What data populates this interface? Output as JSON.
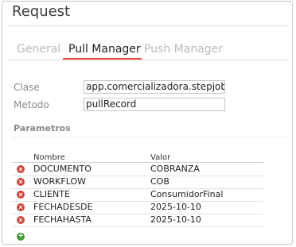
{
  "dialog": {
    "title": "Request"
  },
  "tabs": [
    {
      "label": "General",
      "active": false
    },
    {
      "label": "Pull Manager",
      "active": true
    },
    {
      "label": "Push Manager",
      "active": false
    }
  ],
  "form": {
    "clase_label": "Clase",
    "clase_value": "app.comercializadora.stepjobs.CobranzaWF",
    "metodo_label": "Metodo",
    "metodo_value": "pullRecord"
  },
  "parametros": {
    "title": "Parametros",
    "columns": {
      "nombre": "Nombre",
      "valor": "Valor"
    },
    "rows": [
      {
        "nombre": "DOCUMENTO",
        "valor": "COBRANZA"
      },
      {
        "nombre": "WORKFLOW",
        "valor": "COB"
      },
      {
        "nombre": "CLIENTE",
        "valor": "ConsumidorFinal"
      },
      {
        "nombre": "FECHADESDE",
        "valor": "2025-10-10"
      },
      {
        "nombre": "FECHAHASTA",
        "valor": "2025-10-10"
      }
    ]
  },
  "icons": {
    "delete": "remove-circle-icon",
    "add": "add-circle-icon"
  },
  "colors": {
    "accent": "#e2523a",
    "delete": "#d64236",
    "add": "#3f9b2d"
  }
}
